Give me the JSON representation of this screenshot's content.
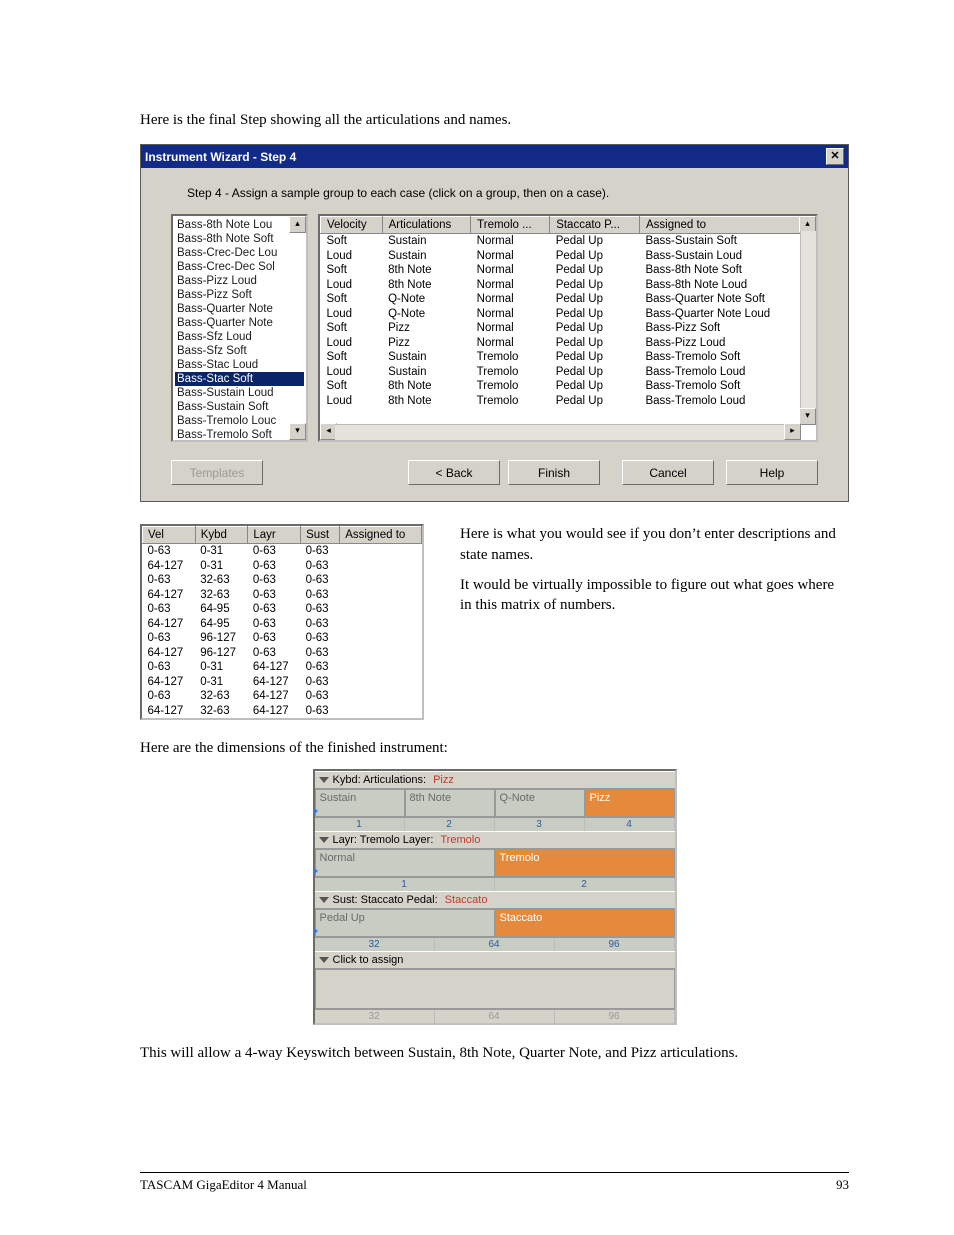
{
  "intro_para": "Here is the final Step showing all the articulations and names.",
  "wizard": {
    "title": "Instrument Wizard - Step 4",
    "instructions": "Step 4 - Assign a sample group to each case (click on a group, then on a case).",
    "listbox": [
      "Bass-8th Note Lou",
      "Bass-8th Note Soft",
      "Bass-Crec-Dec Lou",
      "Bass-Crec-Dec Sol",
      "Bass-Pizz Loud",
      "Bass-Pizz Soft",
      "Bass-Quarter Note",
      "Bass-Quarter Note",
      "Bass-Sfz Loud",
      "Bass-Sfz Soft",
      "Bass-Stac Loud",
      "Bass-Stac Soft",
      "Bass-Sustain Loud",
      "Bass-Sustain Soft",
      "Bass-Tremolo Louc",
      "Bass-Tremolo Soft"
    ],
    "listbox_selected_index": 11,
    "table_headers": [
      "Velocity",
      "Articulations",
      "Tremolo ...",
      "Staccato P...",
      "Assigned to"
    ],
    "table_rows": [
      [
        "Soft",
        "Sustain",
        "Normal",
        "Pedal Up",
        "Bass-Sustain Soft"
      ],
      [
        "Loud",
        "Sustain",
        "Normal",
        "Pedal Up",
        "Bass-Sustain Loud"
      ],
      [
        "Soft",
        "8th Note",
        "Normal",
        "Pedal Up",
        "Bass-8th Note Soft"
      ],
      [
        "Loud",
        "8th Note",
        "Normal",
        "Pedal Up",
        "Bass-8th Note Loud"
      ],
      [
        "Soft",
        "Q-Note",
        "Normal",
        "Pedal Up",
        "Bass-Quarter Note Soft"
      ],
      [
        "Loud",
        "Q-Note",
        "Normal",
        "Pedal Up",
        "Bass-Quarter Note Loud"
      ],
      [
        "Soft",
        "Pizz",
        "Normal",
        "Pedal Up",
        "Bass-Pizz Soft"
      ],
      [
        "Loud",
        "Pizz",
        "Normal",
        "Pedal Up",
        "Bass-Pizz Loud"
      ],
      [
        "Soft",
        "Sustain",
        "Tremolo",
        "Pedal Up",
        "Bass-Tremolo Soft"
      ],
      [
        "Loud",
        "Sustain",
        "Tremolo",
        "Pedal Up",
        "Bass-Tremolo Loud"
      ],
      [
        "Soft",
        "8th Note",
        "Tremolo",
        "Pedal Up",
        "Bass-Tremolo Soft"
      ],
      [
        "Loud",
        "8th Note",
        "Tremolo",
        "Pedal Up",
        "Bass-Tremolo Loud"
      ]
    ],
    "buttons": {
      "templates": "Templates",
      "back": "< Back",
      "finish": "Finish",
      "cancel": "Cancel",
      "help": "Help"
    }
  },
  "right_text_1": "Here is what you would see if you don’t enter descriptions and state names.",
  "right_text_2": "It would be virtually impossible to figure out what goes where in this matrix of numbers.",
  "mini": {
    "headers": [
      "Vel",
      "Kybd",
      "Layr",
      "Sust",
      "Assigned to"
    ],
    "rows": [
      [
        "0-63",
        "0-31",
        "0-63",
        "0-63",
        ""
      ],
      [
        "64-127",
        "0-31",
        "0-63",
        "0-63",
        ""
      ],
      [
        "0-63",
        "32-63",
        "0-63",
        "0-63",
        ""
      ],
      [
        "64-127",
        "32-63",
        "0-63",
        "0-63",
        ""
      ],
      [
        "0-63",
        "64-95",
        "0-63",
        "0-63",
        ""
      ],
      [
        "64-127",
        "64-95",
        "0-63",
        "0-63",
        ""
      ],
      [
        "0-63",
        "96-127",
        "0-63",
        "0-63",
        ""
      ],
      [
        "64-127",
        "96-127",
        "0-63",
        "0-63",
        ""
      ],
      [
        "0-63",
        "0-31",
        "64-127",
        "0-63",
        ""
      ],
      [
        "64-127",
        "0-31",
        "64-127",
        "0-63",
        ""
      ],
      [
        "0-63",
        "32-63",
        "64-127",
        "0-63",
        ""
      ],
      [
        "64-127",
        "32-63",
        "64-127",
        "0-63",
        ""
      ]
    ]
  },
  "mid_para": "Here are the dimensions of the finished instrument:",
  "dim": {
    "s1": {
      "title": "Kybd: Articulations:",
      "sel": "Pizz",
      "cells": [
        "Sustain",
        "8th Note",
        "Q-Note",
        "Pizz"
      ],
      "nums": [
        "1",
        "2",
        "3",
        "4"
      ],
      "active_index": 3
    },
    "s2": {
      "title": "Layr: Tremolo Layer:",
      "sel": "Tremolo",
      "cells": [
        "Normal",
        "Tremolo"
      ],
      "nums": [
        "1",
        "2"
      ],
      "active_index": 1
    },
    "s3": {
      "title": "Sust: Staccato Pedal:",
      "sel": "Staccato",
      "cells": [
        "Pedal Up",
        "Staccato"
      ],
      "nums": [
        "32",
        "64",
        "96"
      ],
      "active_index": 1
    },
    "s4": {
      "title": "Click to assign",
      "nums": [
        "32",
        "64",
        "96"
      ]
    }
  },
  "final_para": "This will allow a 4-way Keyswitch between Sustain, 8th Note, Quarter Note, and Pizz articulations.",
  "footer": {
    "left": "TASCAM GigaEditor 4 Manual",
    "page": "93"
  }
}
